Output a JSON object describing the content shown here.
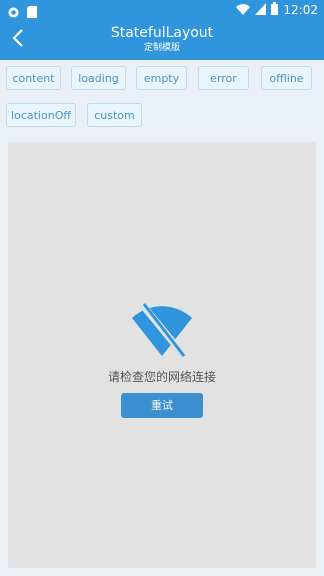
{
  "status_bar": {
    "time": "12:02",
    "left_icons": [
      "record-icon",
      "sd-card-icon"
    ],
    "right_icons": [
      "wifi-icon",
      "signal-icon",
      "battery-icon"
    ]
  },
  "app_bar": {
    "title": "StatefulLayout",
    "subtitle": "定制模版",
    "back_icon": "back-arrow-icon"
  },
  "state_buttons": [
    "content",
    "loading",
    "empty",
    "error",
    "offline",
    "locationOff",
    "custom"
  ],
  "offline_state": {
    "icon": "wifi-off-icon",
    "message": "请检查您的网络连接",
    "retry_label": "重试"
  },
  "colors": {
    "primary": "#2f95dc",
    "button_border": "#b9dcf2",
    "button_text": "#4a92c8",
    "panel": "#e2e2e2",
    "retry": "#3c8fcf"
  }
}
